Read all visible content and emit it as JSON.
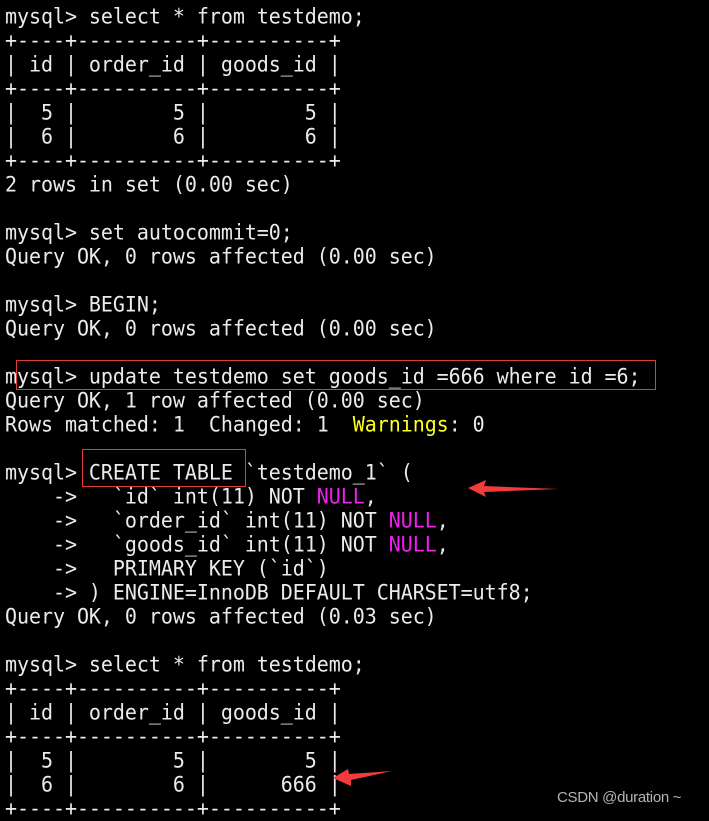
{
  "terminal": {
    "lines": [
      {
        "segments": [
          {
            "text": "mysql> select * from testdemo;"
          }
        ]
      },
      {
        "segments": [
          {
            "text": "+----+----------+----------+"
          }
        ]
      },
      {
        "segments": [
          {
            "text": "| id | order_id | goods_id |"
          }
        ]
      },
      {
        "segments": [
          {
            "text": "+----+----------+----------+"
          }
        ]
      },
      {
        "segments": [
          {
            "text": "|  5 |        5 |        5 |"
          }
        ]
      },
      {
        "segments": [
          {
            "text": "|  6 |        6 |        6 |"
          }
        ]
      },
      {
        "segments": [
          {
            "text": "+----+----------+----------+"
          }
        ]
      },
      {
        "segments": [
          {
            "text": "2 rows in set (0.00 sec)"
          }
        ]
      },
      {
        "segments": [
          {
            "text": ""
          }
        ]
      },
      {
        "segments": [
          {
            "text": "mysql> set autocommit=0;"
          }
        ]
      },
      {
        "segments": [
          {
            "text": "Query OK, 0 rows affected (0.00 sec)"
          }
        ]
      },
      {
        "segments": [
          {
            "text": ""
          }
        ]
      },
      {
        "segments": [
          {
            "text": "mysql> BEGIN;"
          }
        ]
      },
      {
        "segments": [
          {
            "text": "Query OK, 0 rows affected (0.00 sec)"
          }
        ]
      },
      {
        "segments": [
          {
            "text": ""
          }
        ]
      },
      {
        "segments": [
          {
            "text": "mysql> update testdemo set goods_id =666 where id =6;"
          }
        ]
      },
      {
        "segments": [
          {
            "text": "Query OK, 1 row affected (0.00 sec)"
          }
        ]
      },
      {
        "segments": [
          {
            "text": "Rows matched: 1  Changed: 1  "
          },
          {
            "text": "Warnings",
            "style": "warn"
          },
          {
            "text": ": 0"
          }
        ]
      },
      {
        "segments": [
          {
            "text": ""
          }
        ]
      },
      {
        "segments": [
          {
            "text": "mysql> CREATE TABLE `testdemo_1` ("
          }
        ]
      },
      {
        "segments": [
          {
            "text": "    ->   `id` int(11) NOT "
          },
          {
            "text": "NULL",
            "style": "null"
          },
          {
            "text": ","
          }
        ]
      },
      {
        "segments": [
          {
            "text": "    ->   `order_id` int(11) NOT "
          },
          {
            "text": "NULL",
            "style": "null"
          },
          {
            "text": ","
          }
        ]
      },
      {
        "segments": [
          {
            "text": "    ->   `goods_id` int(11) NOT "
          },
          {
            "text": "NULL",
            "style": "null"
          },
          {
            "text": ","
          }
        ]
      },
      {
        "segments": [
          {
            "text": "    ->   PRIMARY KEY (`id`)"
          }
        ]
      },
      {
        "segments": [
          {
            "text": "    -> ) ENGINE=InnoDB DEFAULT CHARSET=utf8;"
          }
        ]
      },
      {
        "segments": [
          {
            "text": "Query OK, 0 rows affected (0.03 sec)"
          }
        ]
      },
      {
        "segments": [
          {
            "text": ""
          }
        ]
      },
      {
        "segments": [
          {
            "text": "mysql> select * from testdemo;"
          }
        ]
      },
      {
        "segments": [
          {
            "text": "+----+----------+----------+"
          }
        ]
      },
      {
        "segments": [
          {
            "text": "| id | order_id | goods_id |"
          }
        ]
      },
      {
        "segments": [
          {
            "text": "+----+----------+----------+"
          }
        ]
      },
      {
        "segments": [
          {
            "text": "|  5 |        5 |        5 |"
          }
        ]
      },
      {
        "segments": [
          {
            "text": "|  6 |        6 |      666 |"
          }
        ]
      },
      {
        "segments": [
          {
            "text": "+----+----------+----------+"
          }
        ]
      }
    ]
  },
  "annotations": {
    "highlight_boxes": [
      "update-statement",
      "create-table-keyword"
    ],
    "arrows": [
      "create-table-arrow",
      "updated-value-arrow"
    ],
    "color": "#e33a3a"
  },
  "colors": {
    "background": "#000000",
    "text": "#ebebeb",
    "null_keyword": "#f020f0",
    "warnings_label": "#ffff20",
    "watermark": "#b4b4b4"
  },
  "watermark": "CSDN @duration ~"
}
